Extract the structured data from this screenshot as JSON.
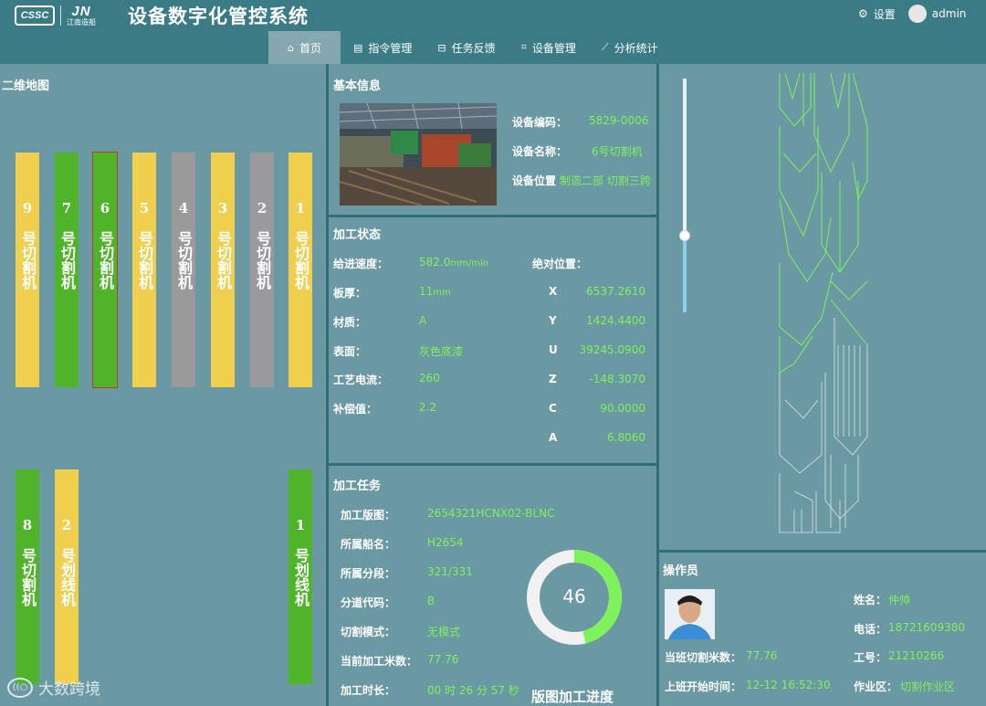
{
  "header": {
    "logo_left": "CSSC",
    "logo_right": "JN",
    "logo_right_sub": "江南造船",
    "title": "设备数字化管控系统",
    "settings_icon": "gear-icon",
    "settings_label": "设置",
    "user": "admin"
  },
  "nav": [
    {
      "icon": "home-icon",
      "label": "首页"
    },
    {
      "icon": "document-icon",
      "label": "指令管理"
    },
    {
      "icon": "lock-icon",
      "label": "任务反馈"
    },
    {
      "icon": "crop-icon",
      "label": "设备管理"
    },
    {
      "icon": "line-chart-icon",
      "label": "分析统计"
    }
  ],
  "map": {
    "title": "二维地图",
    "machines_top": [
      {
        "num": "9",
        "name": "号切割机",
        "color": "#f0cf4e"
      },
      {
        "num": "7",
        "name": "号切割机",
        "color": "#4fb429"
      },
      {
        "num": "6",
        "name": "号切割机",
        "color": "#4fb429",
        "selected": true
      },
      {
        "num": "5",
        "name": "号切割机",
        "color": "#f0cf4e"
      },
      {
        "num": "4",
        "name": "号切割机",
        "color": "#9a9a9a"
      },
      {
        "num": "3",
        "name": "号切割机",
        "color": "#f0cf4e"
      },
      {
        "num": "2",
        "name": "号切割机",
        "color": "#9a9a9a"
      },
      {
        "num": "1",
        "name": "号切割机",
        "color": "#f0cf4e"
      }
    ],
    "machines_bottom": [
      {
        "num": "8",
        "name": "号切割机",
        "color": "#4fb429"
      },
      {
        "num": "2",
        "name": "号划线机",
        "color": "#f0cf4e"
      },
      {
        "num": "1",
        "name": "号划线机",
        "color": "#4fb429"
      }
    ]
  },
  "basic_info": {
    "title": "基本信息",
    "code_label": "设备编码：",
    "code": "5829-0006",
    "name_label": "设备名称：",
    "name": "6号切割机",
    "location_label": "设备位置",
    "location": "制造二部 切割三跨"
  },
  "status": {
    "title": "加工状态",
    "feed_label": "给进速度：",
    "feed_value": "582.0",
    "feed_unit": "mm/min",
    "thickness_label": "板厚：",
    "thickness_value": "11",
    "thickness_unit": "mm",
    "material_label": "材质：",
    "material": "A",
    "surface_label": "表面：",
    "surface": "灰色底漆",
    "current_label": "工艺电流：",
    "current": "260",
    "comp_label": "补偿值：",
    "comp": "2.2",
    "abs_label": "绝对位置：",
    "axes": [
      {
        "axis": "X",
        "value": "6537.2610"
      },
      {
        "axis": "Y",
        "value": "1424.4400"
      },
      {
        "axis": "U",
        "value": "39245.0900"
      },
      {
        "axis": "Z",
        "value": "-148.3070"
      },
      {
        "axis": "C",
        "value": "90.0000"
      },
      {
        "axis": "A",
        "value": "6.8060"
      }
    ]
  },
  "task": {
    "title": "加工任务",
    "rows": [
      {
        "label": "加工版图：",
        "value": "2654321HCNX02-BLNC"
      },
      {
        "label": "所属船名：",
        "value": "H2654"
      },
      {
        "label": "所属分段：",
        "value": "321/331"
      },
      {
        "label": "分道代码：",
        "value": "B"
      },
      {
        "label": "切割模式：",
        "value": "无模式"
      },
      {
        "label": "当前加工米数：",
        "value": "77.76"
      },
      {
        "label": "加工时长：",
        "value": "00 时 26 分 57 秒"
      }
    ],
    "progress_value": 46,
    "progress_label": "版图加工进度",
    "progress_fill_color": "#7ef25c",
    "progress_track_color": "#f1f1f1"
  },
  "operator": {
    "title": "操作员",
    "name_label": "姓名：",
    "name": "仲帅",
    "phone_label": "电话：",
    "phone": "18721609380",
    "id_label": "工号：",
    "id": "21210266",
    "meters_label": "当班切割米数：",
    "meters": "77.76",
    "start_label": "上班开始时间：",
    "start": "12-12 16:52:30",
    "area_label": "作业区：",
    "area": "切割作业区"
  },
  "watermark": "大数跨境"
}
